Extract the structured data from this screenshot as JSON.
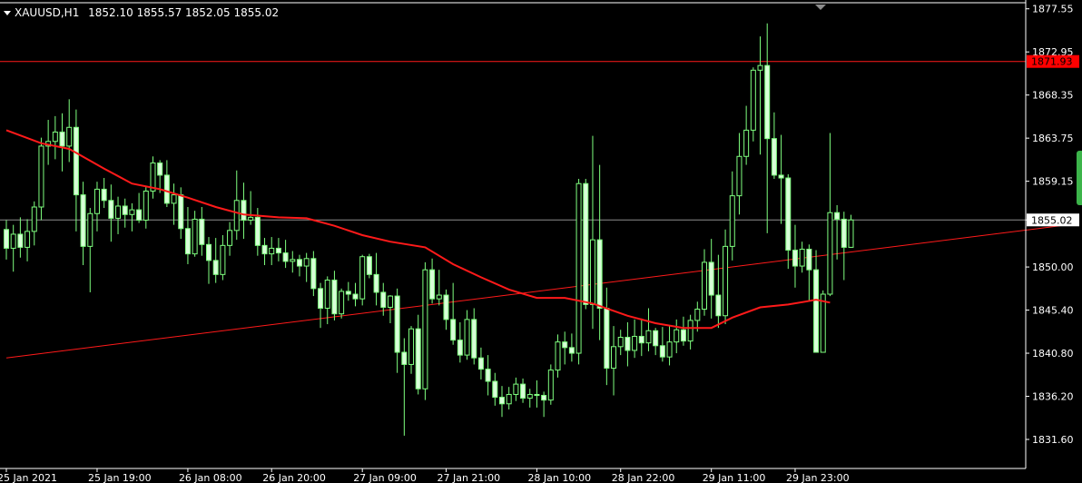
{
  "header": {
    "symbol": "XAUUSD,H1",
    "ohlc": "1852.10 1855.57 1852.05 1855.02"
  },
  "colors": {
    "background": "#000000",
    "axis": "#ffffff",
    "candle": "#7fff7f",
    "bull_body": "#000000",
    "bear_body": "#d8ffd8",
    "ma_line": "#ff1a1a",
    "trend_line": "#ff1a1a",
    "hline": "#ff1a1a",
    "price_line": "#8c8c8c",
    "red_tag_bg": "#ff0000",
    "white_tag_bg": "#ffffff"
  },
  "chart_data": {
    "type": "candlestick",
    "symbol": "XAUUSD",
    "timeframe": "H1",
    "current": {
      "open": 1852.1,
      "high": 1855.57,
      "low": 1852.05,
      "close": 1855.02
    },
    "ylim": [
      1828.5,
      1878.2
    ],
    "y_ticks": [
      1877.55,
      1872.95,
      1868.35,
      1863.75,
      1859.15,
      1855.02,
      1850.0,
      1845.4,
      1840.8,
      1836.2,
      1831.6
    ],
    "x_ticks": [
      "25 Jan 2021",
      "25 Jan 19:00",
      "26 Jan 08:00",
      "26 Jan 20:00",
      "27 Jan 09:00",
      "27 Jan 21:00",
      "28 Jan 10:00",
      "28 Jan 22:00",
      "29 Jan 11:00",
      "29 Jan 23:00"
    ],
    "x_tick_positions": [
      0,
      13,
      26,
      38,
      51,
      63,
      76,
      88,
      101,
      113
    ],
    "horizontal_line": 1871.93,
    "price_line": 1855.02,
    "trend_line": {
      "start": [
        0,
        1840.3
      ],
      "end": [
        151,
        1854.4
      ]
    },
    "moving_average": [
      [
        0,
        1864.6
      ],
      [
        5,
        1863.2
      ],
      [
        9,
        1862.6
      ],
      [
        14,
        1860.5
      ],
      [
        18,
        1858.9
      ],
      [
        22,
        1858.3
      ],
      [
        26,
        1857.4
      ],
      [
        30,
        1856.4
      ],
      [
        34,
        1855.6
      ],
      [
        39,
        1855.3
      ],
      [
        43,
        1855.2
      ],
      [
        47,
        1854.4
      ],
      [
        51,
        1853.4
      ],
      [
        55,
        1852.7
      ],
      [
        60,
        1852.1
      ],
      [
        64,
        1850.3
      ],
      [
        68,
        1848.9
      ],
      [
        72,
        1847.6
      ],
      [
        76,
        1846.7
      ],
      [
        80,
        1846.7
      ],
      [
        84,
        1846.1
      ],
      [
        89,
        1844.8
      ],
      [
        93,
        1844.0
      ],
      [
        97,
        1843.5
      ],
      [
        101,
        1843.5
      ],
      [
        104,
        1844.6
      ],
      [
        108,
        1845.7
      ],
      [
        112,
        1846.0
      ],
      [
        116,
        1846.5
      ],
      [
        118,
        1846.2
      ]
    ],
    "candles": [
      [
        1854.0,
        1855.0,
        1850.8,
        1852.0
      ],
      [
        1852.0,
        1854.5,
        1849.5,
        1853.5
      ],
      [
        1853.5,
        1855.3,
        1851.0,
        1852.1
      ],
      [
        1852.1,
        1855.1,
        1850.6,
        1853.8
      ],
      [
        1853.8,
        1857.0,
        1852.3,
        1856.4
      ],
      [
        1856.4,
        1863.8,
        1855.0,
        1862.9
      ],
      [
        1862.9,
        1865.7,
        1860.9,
        1863.4
      ],
      [
        1863.4,
        1866.1,
        1861.5,
        1864.4
      ],
      [
        1864.4,
        1866.4,
        1860.2,
        1862.9
      ],
      [
        1862.9,
        1867.9,
        1861.2,
        1864.9
      ],
      [
        1864.9,
        1866.8,
        1853.8,
        1857.7
      ],
      [
        1857.7,
        1859.1,
        1850.2,
        1852.2
      ],
      [
        1852.2,
        1856.3,
        1847.3,
        1855.7
      ],
      [
        1855.7,
        1859.1,
        1853.8,
        1858.3
      ],
      [
        1858.3,
        1859.5,
        1856.3,
        1857.1
      ],
      [
        1857.1,
        1858.8,
        1852.7,
        1855.2
      ],
      [
        1855.2,
        1857.5,
        1853.5,
        1856.5
      ],
      [
        1856.5,
        1857.3,
        1854.2,
        1855.6
      ],
      [
        1855.6,
        1856.8,
        1853.8,
        1856.1
      ],
      [
        1856.1,
        1857.9,
        1854.7,
        1855.0
      ],
      [
        1855.0,
        1858.6,
        1854.1,
        1858.1
      ],
      [
        1858.1,
        1861.8,
        1857.3,
        1861.1
      ],
      [
        1861.1,
        1861.4,
        1857.9,
        1859.8
      ],
      [
        1859.8,
        1861.4,
        1856.4,
        1856.8
      ],
      [
        1856.8,
        1858.9,
        1854.5,
        1857.7
      ],
      [
        1857.7,
        1858.5,
        1853.0,
        1854.1
      ],
      [
        1854.1,
        1856.4,
        1850.3,
        1851.4
      ],
      [
        1851.4,
        1856.0,
        1851.1,
        1855.1
      ],
      [
        1855.1,
        1856.4,
        1851.2,
        1852.4
      ],
      [
        1852.4,
        1853.2,
        1848.2,
        1850.7
      ],
      [
        1850.7,
        1853.1,
        1848.3,
        1849.2
      ],
      [
        1849.2,
        1853.4,
        1848.6,
        1852.3
      ],
      [
        1852.3,
        1854.8,
        1851.2,
        1853.9
      ],
      [
        1853.9,
        1860.3,
        1852.9,
        1857.1
      ],
      [
        1857.1,
        1859.0,
        1853.0,
        1855.0
      ],
      [
        1855.0,
        1858.1,
        1854.5,
        1855.3
      ],
      [
        1855.3,
        1856.3,
        1851.2,
        1852.3
      ],
      [
        1852.3,
        1853.1,
        1850.2,
        1851.4
      ],
      [
        1851.4,
        1853.2,
        1850.2,
        1852.0
      ],
      [
        1852.0,
        1853.1,
        1850.6,
        1851.5
      ],
      [
        1851.5,
        1852.9,
        1849.9,
        1850.6
      ],
      [
        1850.6,
        1851.7,
        1849.4,
        1850.8
      ],
      [
        1850.8,
        1851.3,
        1849.0,
        1850.1
      ],
      [
        1850.1,
        1851.5,
        1848.4,
        1850.9
      ],
      [
        1850.9,
        1851.7,
        1846.9,
        1847.7
      ],
      [
        1847.7,
        1848.3,
        1843.5,
        1845.6
      ],
      [
        1845.6,
        1849.0,
        1843.9,
        1848.6
      ],
      [
        1848.6,
        1849.6,
        1844.3,
        1845.0
      ],
      [
        1845.0,
        1847.7,
        1844.5,
        1847.4
      ],
      [
        1847.4,
        1848.4,
        1846.4,
        1847.1
      ],
      [
        1847.1,
        1848.3,
        1845.8,
        1846.6
      ],
      [
        1846.6,
        1851.3,
        1845.9,
        1851.1
      ],
      [
        1851.1,
        1851.4,
        1848.8,
        1849.2
      ],
      [
        1849.2,
        1851.5,
        1845.9,
        1847.3
      ],
      [
        1847.3,
        1848.3,
        1844.8,
        1845.7
      ],
      [
        1845.7,
        1847.0,
        1844.0,
        1846.9
      ],
      [
        1846.9,
        1847.7,
        1838.7,
        1840.9
      ],
      [
        1840.9,
        1842.4,
        1832.0,
        1839.6
      ],
      [
        1839.6,
        1843.7,
        1838.6,
        1843.4
      ],
      [
        1843.4,
        1844.9,
        1836.4,
        1837.0
      ],
      [
        1837.0,
        1850.5,
        1835.8,
        1849.7
      ],
      [
        1849.7,
        1850.9,
        1846.1,
        1846.6
      ],
      [
        1846.6,
        1849.7,
        1845.9,
        1847.0
      ],
      [
        1847.0,
        1847.6,
        1843.3,
        1844.4
      ],
      [
        1844.4,
        1848.3,
        1841.7,
        1842.2
      ],
      [
        1842.2,
        1844.1,
        1839.8,
        1840.6
      ],
      [
        1840.6,
        1845.4,
        1840.1,
        1844.4
      ],
      [
        1844.4,
        1845.6,
        1839.6,
        1840.3
      ],
      [
        1840.3,
        1841.4,
        1838.0,
        1839.1
      ],
      [
        1839.1,
        1840.6,
        1836.3,
        1837.8
      ],
      [
        1837.8,
        1838.7,
        1835.2,
        1836.1
      ],
      [
        1836.1,
        1837.3,
        1834.0,
        1835.4
      ],
      [
        1835.4,
        1837.2,
        1834.8,
        1836.4
      ],
      [
        1836.4,
        1838.2,
        1835.7,
        1837.5
      ],
      [
        1837.5,
        1838.1,
        1835.5,
        1836.0
      ],
      [
        1836.0,
        1837.0,
        1835.0,
        1836.4
      ],
      [
        1836.4,
        1837.9,
        1835.0,
        1836.3
      ],
      [
        1836.3,
        1836.7,
        1834.0,
        1835.8
      ],
      [
        1835.8,
        1839.6,
        1835.3,
        1839.0
      ],
      [
        1839.0,
        1842.8,
        1838.2,
        1842.0
      ],
      [
        1842.0,
        1843.1,
        1839.6,
        1841.4
      ],
      [
        1841.4,
        1842.9,
        1839.9,
        1840.8
      ],
      [
        1840.8,
        1859.4,
        1839.6,
        1858.9
      ],
      [
        1858.9,
        1859.4,
        1845.5,
        1846.0
      ],
      [
        1846.0,
        1864.0,
        1843.4,
        1852.9
      ],
      [
        1852.9,
        1860.9,
        1842.2,
        1845.6
      ],
      [
        1845.6,
        1847.8,
        1837.4,
        1839.2
      ],
      [
        1839.2,
        1843.7,
        1836.3,
        1841.5
      ],
      [
        1841.5,
        1843.3,
        1840.6,
        1842.5
      ],
      [
        1842.5,
        1844.1,
        1839.4,
        1841.1
      ],
      [
        1841.1,
        1844.4,
        1840.3,
        1842.6
      ],
      [
        1842.6,
        1844.5,
        1840.5,
        1841.9
      ],
      [
        1841.9,
        1845.6,
        1841.0,
        1843.2
      ],
      [
        1843.2,
        1843.5,
        1840.6,
        1841.6
      ],
      [
        1841.6,
        1843.6,
        1839.9,
        1840.4
      ],
      [
        1840.4,
        1843.7,
        1839.5,
        1842.0
      ],
      [
        1842.0,
        1844.4,
        1840.8,
        1843.3
      ],
      [
        1843.3,
        1844.7,
        1841.6,
        1842.1
      ],
      [
        1842.1,
        1844.9,
        1841.2,
        1844.3
      ],
      [
        1844.3,
        1846.3,
        1843.1,
        1845.5
      ],
      [
        1845.5,
        1851.9,
        1844.8,
        1850.5
      ],
      [
        1850.5,
        1853.0,
        1844.5,
        1847.0
      ],
      [
        1847.0,
        1851.3,
        1843.5,
        1844.8
      ],
      [
        1844.8,
        1854.0,
        1843.9,
        1852.2
      ],
      [
        1852.2,
        1860.2,
        1850.7,
        1857.6
      ],
      [
        1857.6,
        1864.3,
        1855.6,
        1861.8
      ],
      [
        1861.8,
        1867.2,
        1860.9,
        1864.6
      ],
      [
        1864.6,
        1871.3,
        1863.4,
        1871.0
      ],
      [
        1871.0,
        1874.6,
        1862.0,
        1871.5
      ],
      [
        1871.5,
        1876.0,
        1853.6,
        1863.7
      ],
      [
        1863.7,
        1866.5,
        1859.4,
        1859.8
      ],
      [
        1859.8,
        1864.1,
        1854.6,
        1859.5
      ],
      [
        1859.5,
        1859.9,
        1849.8,
        1851.8
      ],
      [
        1851.8,
        1854.5,
        1847.8,
        1850.1
      ],
      [
        1850.1,
        1852.7,
        1849.4,
        1851.9
      ],
      [
        1851.9,
        1852.4,
        1846.3,
        1849.7
      ],
      [
        1849.7,
        1851.8,
        1840.9,
        1840.9
      ],
      [
        1840.9,
        1847.5,
        1840.9,
        1847.1
      ],
      [
        1847.1,
        1864.3,
        1846.9,
        1855.8
      ],
      [
        1855.8,
        1856.6,
        1850.8,
        1855.1
      ],
      [
        1855.1,
        1855.9,
        1848.6,
        1852.1
      ],
      [
        1852.1,
        1855.57,
        1852.05,
        1855.02
      ]
    ]
  }
}
